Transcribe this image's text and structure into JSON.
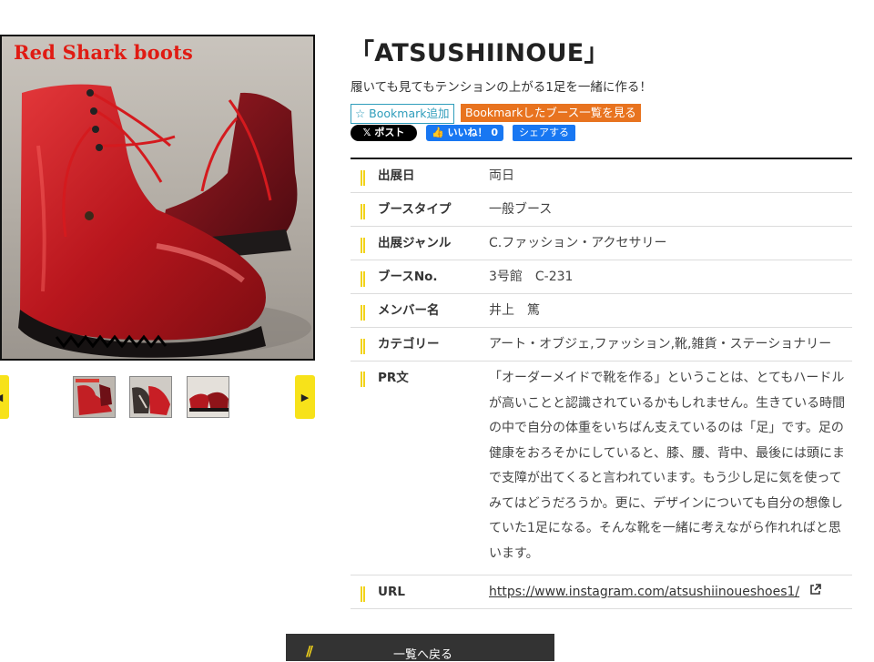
{
  "photo": {
    "caption": "Red Shark boots"
  },
  "thumbnails": {
    "prev": "◀",
    "next": "▶",
    "count": 3
  },
  "title": "「ATSUSHIINOUE」",
  "subtitle": "履いても見てもテンションの上がる1足を一緒に作る！",
  "bookmark": {
    "add_label": "☆ Bookmark追加",
    "list_label": "Bookmarkしたブース一覧を見る"
  },
  "social": {
    "post_label": "𝕏 ポスト",
    "like_label": "👍 いいね！ 0",
    "share_label": "シェアする"
  },
  "info": {
    "rows": [
      {
        "label": "出展日",
        "value": "両日"
      },
      {
        "label": "ブースタイプ",
        "value": "一般ブース"
      },
      {
        "label": "出展ジャンル",
        "value": "C.ファッション・アクセサリー"
      },
      {
        "label": "ブースNo.",
        "value": "3号館　C-231"
      },
      {
        "label": "メンバー名",
        "value": "井上　篤"
      },
      {
        "label": "カテゴリー",
        "value": "アート・オブジェ,ファッション,靴,雑貨・ステーショナリー"
      }
    ],
    "pr": {
      "label": "PR文",
      "lines": [
        "「オーダーメイドで靴を作る」ということは、とてもハードル",
        "が高いことと認識されているかもしれません。生きている時間",
        "の中で自分の体重をいちばん支えているのは「足」です。足の",
        "健康をおろそかにしていると、膝、腰、背中、最後には頭にま",
        "で支障が出てくると言われています。もう少し足に気を使って",
        "みてはどうだろうか。更に、デザインについても自分の想像し",
        "ていた1足になる。そんな靴を一緒に考えながら作れればと思",
        "います。"
      ]
    },
    "url": {
      "label": "URL",
      "value": "https://www.instagram.com/atsushiinoueshoes1/",
      "icon": "external-link-icon"
    }
  },
  "back_button": {
    "label": "一覧へ戻る",
    "icon": "double-chevron-left-icon"
  },
  "colors": {
    "accent_yellow": "#f2d31a",
    "bookmark_orange": "#e8731f",
    "facebook_blue": "#1877f2",
    "boot_red": "#c41e22"
  }
}
